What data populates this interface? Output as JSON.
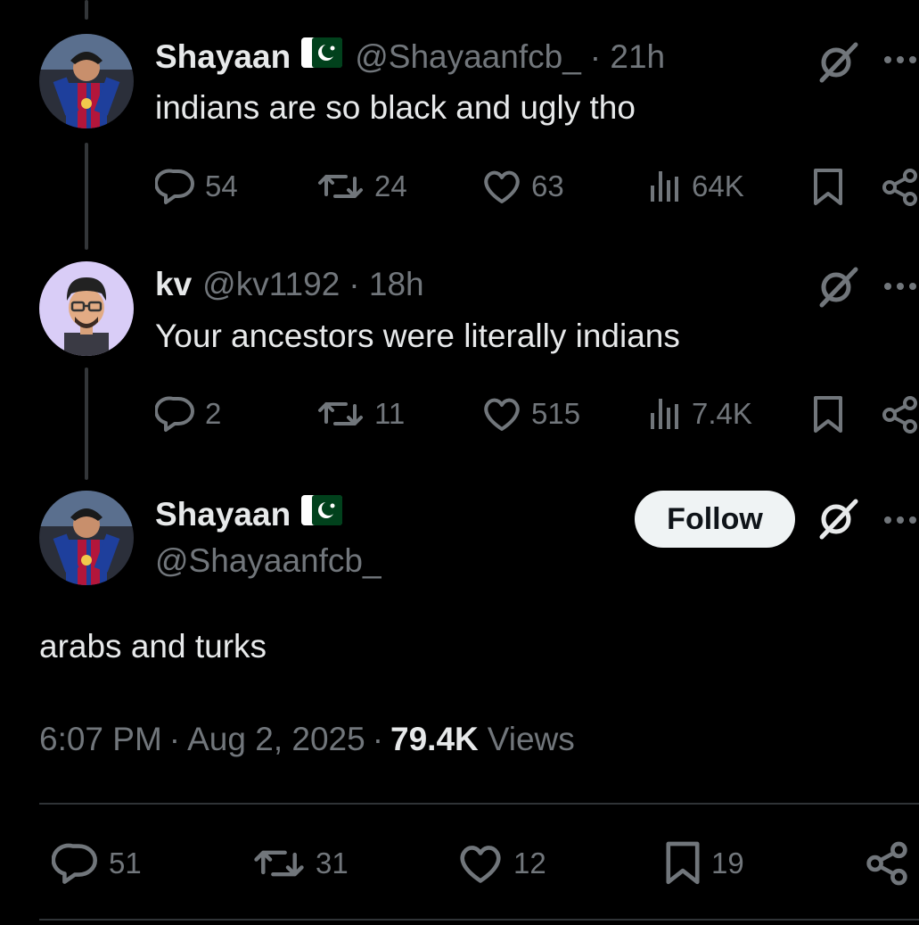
{
  "colors": {
    "background": "#000000",
    "text": "#e7e9ea",
    "muted": "#71767b",
    "pk_green": "#01411c"
  },
  "tweets": [
    {
      "name": "Shayaan",
      "handle": "@Shayaanfcb_",
      "time": "· 21h",
      "text": "indians are so black and ugly tho",
      "stats": {
        "replies": "54",
        "reposts": "24",
        "likes": "63",
        "views": "64K"
      }
    },
    {
      "name": "kv",
      "handle": "@kv1192",
      "time": "· 18h",
      "text": "Your ancestors were literally indians",
      "stats": {
        "replies": "2",
        "reposts": "11",
        "likes": "515",
        "views": "7.4K"
      }
    }
  ],
  "main": {
    "name": "Shayaan",
    "handle": "@Shayaanfcb_",
    "follow_label": "Follow",
    "text": "arabs and turks",
    "time": "6:07 PM",
    "date": "Aug 2, 2025",
    "views_count": "79.4K",
    "views_label": "Views",
    "stats": {
      "replies": "51",
      "reposts": "31",
      "likes": "12",
      "bookmarks": "19"
    }
  },
  "icons": [
    "reply-icon",
    "repost-icon",
    "like-icon",
    "views-icon",
    "bookmark-icon",
    "share-icon",
    "grok-icon",
    "more-icon",
    "pakistan-flag-icon"
  ]
}
